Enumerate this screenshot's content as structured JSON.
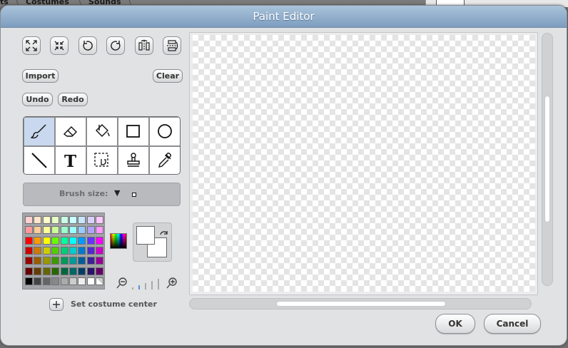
{
  "background_app": {
    "tabs": [
      {
        "label": "ts"
      },
      {
        "label": "Costumes"
      },
      {
        "label": "Sounds"
      }
    ]
  },
  "dialog": {
    "title": "Paint Editor",
    "toolbar_icons": [
      {
        "name": "grow-icon"
      },
      {
        "name": "shrink-icon"
      },
      {
        "name": "rotate-ccw-icon"
      },
      {
        "name": "rotate-cw-icon"
      },
      {
        "name": "flip-horizontal-icon"
      },
      {
        "name": "flip-vertical-icon"
      }
    ],
    "import_label": "Import",
    "clear_label": "Clear",
    "undo_label": "Undo",
    "redo_label": "Redo",
    "tools": [
      {
        "name": "paintbrush-tool",
        "selected": true
      },
      {
        "name": "eraser-tool",
        "selected": false
      },
      {
        "name": "fill-tool",
        "selected": false
      },
      {
        "name": "rectangle-tool",
        "selected": false
      },
      {
        "name": "ellipse-tool",
        "selected": false
      },
      {
        "name": "line-tool",
        "selected": false
      },
      {
        "name": "text-tool",
        "selected": false
      },
      {
        "name": "select-tool",
        "selected": false
      },
      {
        "name": "stamp-tool",
        "selected": false
      },
      {
        "name": "eyedropper-tool",
        "selected": false
      }
    ],
    "brush_size_label": "Brush size:",
    "palette_colors": [
      [
        "#ffd0d0",
        "#ffe6c8",
        "#ffffc8",
        "#e6ffc8",
        "#c8ffe6",
        "#c8ffff",
        "#c8e6ff",
        "#dcd0ff",
        "#ffc8ff"
      ],
      [
        "#ff9a9a",
        "#ffcc99",
        "#ffff99",
        "#ccff99",
        "#99ffcc",
        "#99ffff",
        "#99ccff",
        "#b4a0ff",
        "#ff99ff"
      ],
      [
        "#ff0000",
        "#ff9900",
        "#ffff00",
        "#66ff00",
        "#00ff99",
        "#00ffff",
        "#0099ff",
        "#6633ff",
        "#ff00ff"
      ],
      [
        "#cc0000",
        "#cc7a00",
        "#cccc00",
        "#52cc00",
        "#00cc7a",
        "#00cccc",
        "#007acc",
        "#5229cc",
        "#cc00cc"
      ],
      [
        "#990000",
        "#995c00",
        "#999900",
        "#3d9900",
        "#00995c",
        "#009999",
        "#005c99",
        "#3d1f99",
        "#990099"
      ],
      [
        "#660000",
        "#663d00",
        "#666600",
        "#296600",
        "#00663d",
        "#006666",
        "#003d66",
        "#291466",
        "#660066"
      ],
      [
        "#000000",
        "#444444",
        "#666666",
        "#888888",
        "#aaaaaa",
        "#cccccc",
        "#eeeeee",
        "#ffffff",
        "transparent"
      ]
    ],
    "foreground_color": "#ffffff",
    "background_color": "#ffffff",
    "set_center_label": "Set costume center",
    "ok_label": "OK",
    "cancel_label": "Cancel"
  }
}
